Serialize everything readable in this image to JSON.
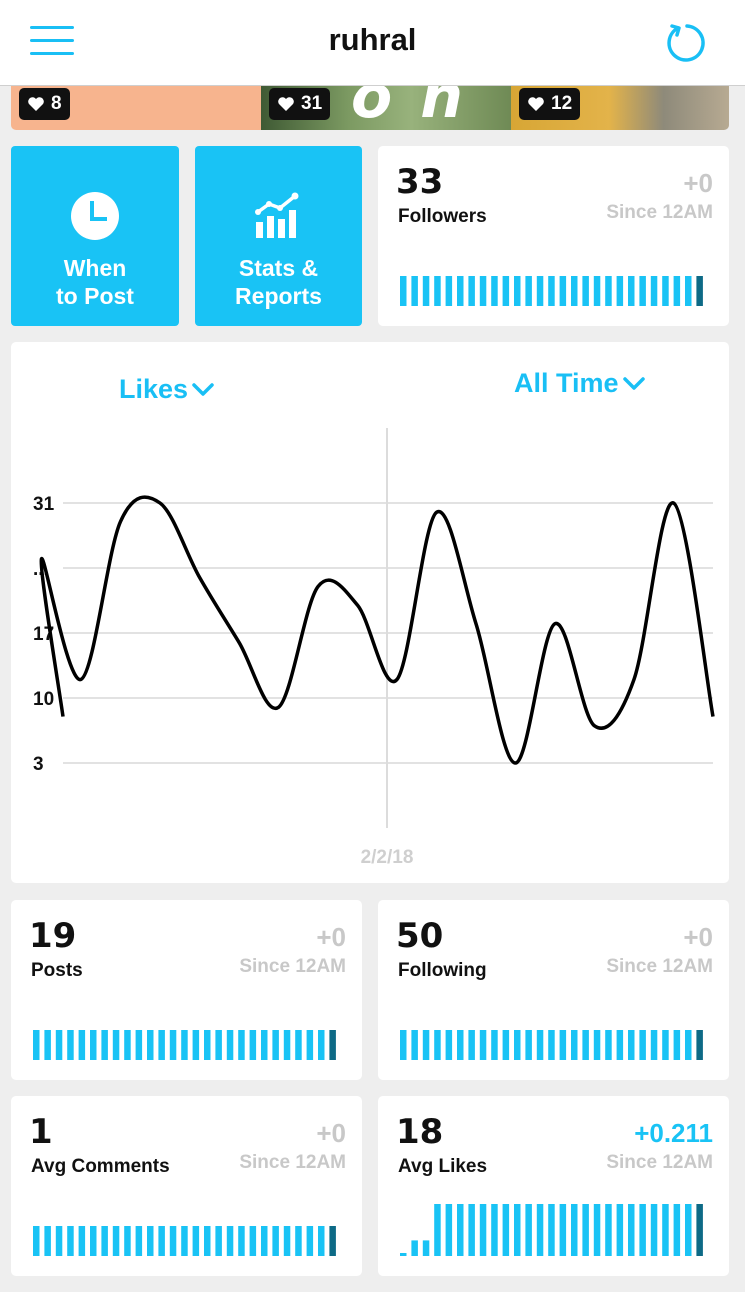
{
  "header": {
    "title": "ruhral"
  },
  "photos": [
    {
      "likes": "8"
    },
    {
      "likes": "31"
    },
    {
      "likes": "12"
    }
  ],
  "tiles": {
    "when_to_post": "When\nto Post",
    "stats_reports": "Stats &\nReports"
  },
  "followers": {
    "value": "33",
    "label": "Followers",
    "delta": "+0",
    "since": "Since 12AM"
  },
  "posts": {
    "value": "19",
    "label": "Posts",
    "delta": "+0",
    "since": "Since 12AM"
  },
  "following": {
    "value": "50",
    "label": "Following",
    "delta": "+0",
    "since": "Since 12AM"
  },
  "avg_comments": {
    "value": "1",
    "label": "Avg Comments",
    "delta": "+0",
    "since": "Since 12AM"
  },
  "avg_likes": {
    "value": "18",
    "label": "Avg Likes",
    "delta": "+0.211",
    "since": "Since 12AM",
    "bar_levels": [
      0.05,
      0.3,
      0.3,
      1,
      1,
      1,
      1,
      1,
      1,
      1,
      1,
      1,
      1,
      1,
      1,
      1,
      1,
      1,
      1,
      1,
      1,
      1,
      1,
      1,
      1,
      1,
      1
    ]
  },
  "chart": {
    "metric_label": "Likes",
    "range_label": "All Time",
    "date_marker": "2/2/18"
  },
  "chart_data": {
    "type": "line",
    "ylabel_ticks": [
      "31",
      "...",
      "17",
      "10",
      "3"
    ],
    "ylim": [
      3,
      31
    ],
    "series": [
      {
        "values": [
          8,
          25,
          12,
          29,
          31,
          23,
          16,
          9,
          22,
          20,
          12,
          30,
          18,
          3,
          18,
          7,
          12,
          31,
          8
        ]
      }
    ],
    "x_marker": "2/2/18",
    "grid": true
  },
  "colors": {
    "accent": "#19c3f5",
    "accent_dark": "#0d6a86",
    "muted": "#c8c8c8"
  }
}
